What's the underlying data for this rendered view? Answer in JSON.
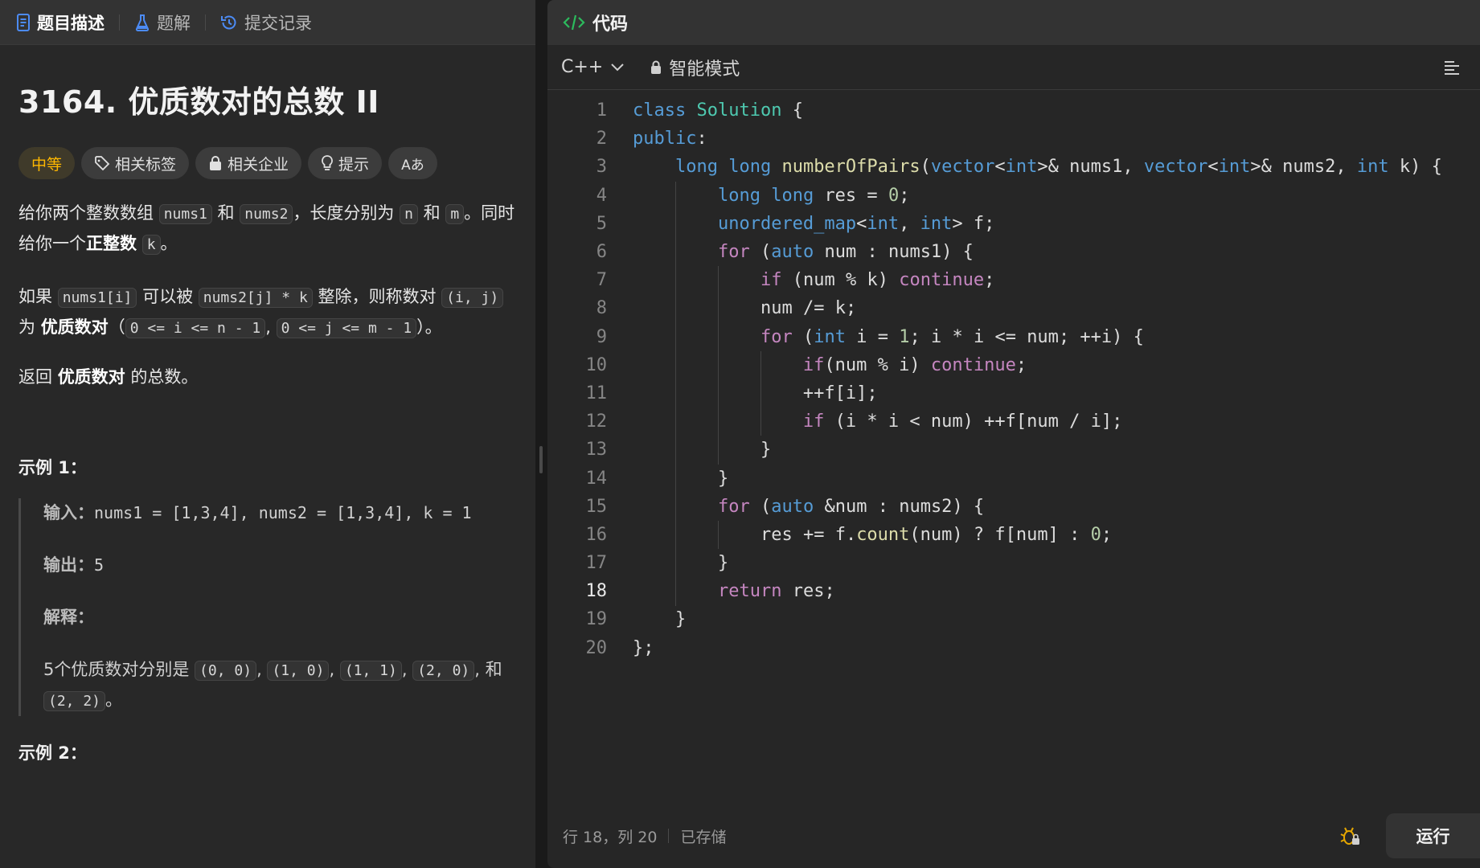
{
  "left_tabs": [
    {
      "label": "题目描述",
      "icon": "document-icon"
    },
    {
      "label": "题解",
      "icon": "flask-icon"
    },
    {
      "label": "提交记录",
      "icon": "history-icon"
    }
  ],
  "problem": {
    "title": "3164. 优质数对的总数 II",
    "tags": [
      "中等",
      "相关标签",
      "相关企业",
      "提示",
      "Aあ"
    ],
    "p1": {
      "a": "给你两个整数数组 ",
      "c1": "nums1",
      "b": " 和 ",
      "c2": "nums2",
      "c": "，长度分别为 ",
      "c3": "n",
      "d": " 和 ",
      "c4": "m",
      "e": "。同时给你一个",
      "bold": "正整数",
      "f": " ",
      "c5": "k",
      "g": "。"
    },
    "p2": {
      "a": "如果 ",
      "c1": "nums1[i]",
      "b": " 可以被 ",
      "c2": "nums2[j] * k",
      "c": " 整除，则称数对 ",
      "c3": "(i, j)",
      "d": " 为 ",
      "bold": "优质数对",
      "e": "（",
      "c4": "0 <= i <= n - 1",
      "f": ", ",
      "c5": "0 <= j <= m - 1",
      "g": "）。"
    },
    "p3": {
      "a": "返回 ",
      "bold": "优质数对",
      "b": " 的总数。"
    },
    "example1_title": "示例 1：",
    "example1": {
      "input_label": "输入：",
      "input_value": "nums1 = [1,3,4], nums2 = [1,3,4], k = 1",
      "output_label": "输出：",
      "output_value": "5",
      "explain_label": "解释：",
      "explain_text": "5个优质数对分别是 ",
      "pairs": [
        "(0, 0)",
        "(1, 0)",
        "(1, 1)",
        "(2, 0)",
        "(2, 2)"
      ],
      "sep": ", ",
      "and": "和 ",
      "end": "。"
    },
    "example2_title": "示例 2："
  },
  "editor": {
    "title": "代码",
    "language": "C++",
    "mode": "智能模式",
    "current_line": 18,
    "status_position": "行 18，列 20",
    "status_saved": "已存储",
    "run_label": "运行"
  },
  "code_lines": [
    "class Solution {",
    "public:",
    "    long long numberOfPairs(vector<int>& nums1, vector<int>& nums2, int k) {",
    "        long long res = 0;",
    "        unordered_map<int, int> f;",
    "        for (auto num : nums1) {",
    "            if (num % k) continue;",
    "            num /= k;",
    "            for (int i = 1; i * i <= num; ++i) {",
    "                if(num % i) continue;",
    "                ++f[i];",
    "                if (i * i < num) ++f[num / i];",
    "            }",
    "        }",
    "        for (auto &num : nums2) {",
    "            res += f.count(num) ? f[num] : 0;",
    "        }",
    "        return res;",
    "    }",
    "};"
  ]
}
